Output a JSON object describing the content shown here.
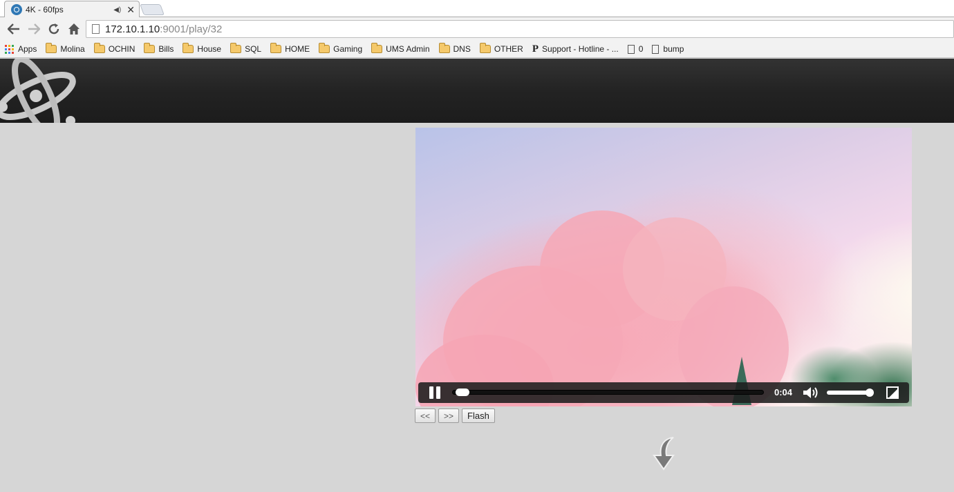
{
  "browser": {
    "tab": {
      "title": "4K - 60fps",
      "audio_icon": "speaker-icon",
      "close_icon": "close-icon"
    },
    "nav": {
      "back": "back-arrow-icon",
      "forward": "forward-arrow-icon",
      "reload": "reload-icon",
      "home": "home-icon"
    },
    "url": {
      "host": "172.10.1.10",
      "rest": ":9001/play/32"
    },
    "bookmarks": [
      {
        "label": "Apps",
        "type": "apps"
      },
      {
        "label": "Molina",
        "type": "folder"
      },
      {
        "label": "OCHIN",
        "type": "folder"
      },
      {
        "label": "Bills",
        "type": "folder"
      },
      {
        "label": "House",
        "type": "folder"
      },
      {
        "label": "SQL",
        "type": "folder"
      },
      {
        "label": "HOME",
        "type": "folder"
      },
      {
        "label": "Gaming",
        "type": "folder"
      },
      {
        "label": "UMS Admin",
        "type": "folder"
      },
      {
        "label": "DNS",
        "type": "folder"
      },
      {
        "label": "OTHER",
        "type": "folder"
      },
      {
        "label": "Support - Hotline - ...",
        "type": "p"
      },
      {
        "label": "0",
        "type": "doc"
      },
      {
        "label": "bump",
        "type": "doc"
      }
    ]
  },
  "player": {
    "time": "0:04",
    "progress": 0.01,
    "volume": 1.0
  },
  "buttons": {
    "prev": "<<",
    "next": ">>",
    "flash": "Flash"
  },
  "colors": {
    "header": "#232323",
    "page": "#d6d6d6",
    "control_bar": "#1e1e1e"
  }
}
